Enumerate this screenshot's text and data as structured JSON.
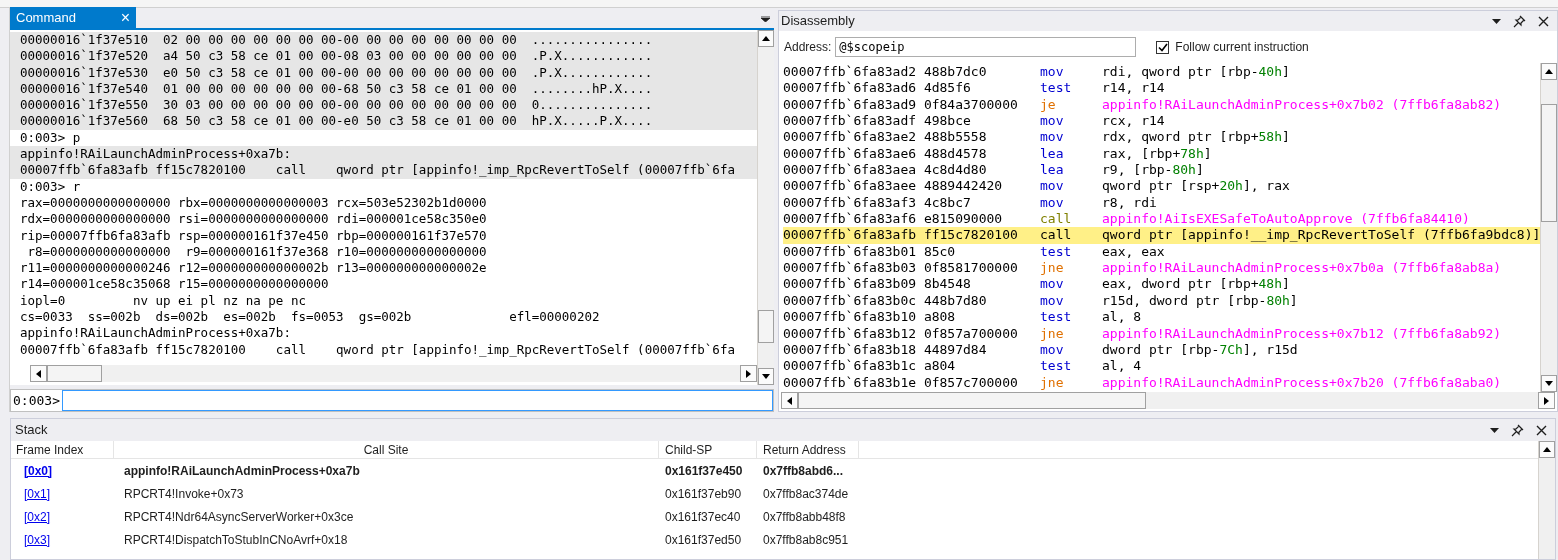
{
  "command_panel": {
    "tab": {
      "label": "Command",
      "selected": true,
      "close": "×"
    },
    "lines": [
      {
        "text": "00000016`1f37e510  02 00 00 00 00 00 00 00-00 00 00 00 00 00 00 00  ................",
        "shaded": true
      },
      {
        "text": "00000016`1f37e520  a4 50 c3 58 ce 01 00 00-08 03 00 00 00 00 00 00  .P.X............",
        "shaded": true
      },
      {
        "text": "00000016`1f37e530  e0 50 c3 58 ce 01 00 00-00 00 00 00 00 00 00 00  .P.X............",
        "shaded": true
      },
      {
        "text": "00000016`1f37e540  01 00 00 00 00 00 00 00-68 50 c3 58 ce 01 00 00  ........hP.X....",
        "shaded": true
      },
      {
        "text": "00000016`1f37e550  30 03 00 00 00 00 00 00-00 00 00 00 00 00 00 00  0...............",
        "shaded": true
      },
      {
        "text": "00000016`1f37e560  68 50 c3 58 ce 01 00 00-e0 50 c3 58 ce 01 00 00  hP.X.....P.X....",
        "shaded": true
      },
      {
        "text": "0:003> p",
        "shaded": false
      },
      {
        "text": "appinfo!RAiLaunchAdminProcess+0xa7b:",
        "shaded": true
      },
      {
        "text": "00007ffb`6fa83afb ff15c7820100    call    qword ptr [appinfo!_imp_RpcRevertToSelf (00007ffb`6fa",
        "shaded": true
      },
      {
        "text": "0:003> r",
        "shaded": false
      },
      {
        "text": "rax=0000000000000000 rbx=0000000000000003 rcx=503e52302b1d0000",
        "shaded": false
      },
      {
        "text": "rdx=0000000000000000 rsi=0000000000000000 rdi=000001ce58c350e0",
        "shaded": false
      },
      {
        "text": "rip=00007ffb6fa83afb rsp=000000161f37e450 rbp=000000161f37e570",
        "shaded": false
      },
      {
        "text": " r8=0000000000000000  r9=000000161f37e368 r10=0000000000000000",
        "shaded": false
      },
      {
        "text": "r11=0000000000000246 r12=000000000000002b r13=000000000000002e",
        "shaded": false
      },
      {
        "text": "r14=000001ce58c35068 r15=0000000000000000",
        "shaded": false
      },
      {
        "text": "iopl=0         nv up ei pl nz na pe nc",
        "shaded": false
      },
      {
        "text": "cs=0033  ss=002b  ds=002b  es=002b  fs=0053  gs=002b             efl=00000202",
        "shaded": false
      },
      {
        "text": "appinfo!RAiLaunchAdminProcess+0xa7b:",
        "shaded": false
      },
      {
        "text": "00007ffb`6fa83afb ff15c7820100    call    qword ptr [appinfo!_imp_RpcRevertToSelf (00007ffb`6fa",
        "shaded": false
      }
    ],
    "prompt": "0:003>"
  },
  "disassembly": {
    "title": "Disassembly",
    "address_label": "Address:",
    "address_value": "@$scopeip",
    "follow": {
      "label": "Follow current instruction",
      "checked": true
    },
    "rows": [
      {
        "addr": "00007ffb`6fa83ad2 488b7dc0",
        "mnemonic": "mov",
        "kind": "data",
        "current": false,
        "operands": [
          {
            "t": "rdi, qword ptr [rbp-",
            "kind": "plain"
          },
          {
            "t": "40h",
            "kind": "number"
          },
          {
            "t": "]",
            "kind": "plain"
          }
        ]
      },
      {
        "addr": "00007ffb`6fa83ad6 4d85f6",
        "mnemonic": "test",
        "kind": "data",
        "current": false,
        "operands": [
          {
            "t": "r14, r14",
            "kind": "plain"
          }
        ]
      },
      {
        "addr": "00007ffb`6fa83ad9 0f84a3700000",
        "mnemonic": "je",
        "kind": "branch",
        "current": false,
        "operands": [
          {
            "t": "appinfo!RAiLaunchAdminProcess+0x7b02 (7ffb6fa8ab82)",
            "kind": "symbol"
          }
        ]
      },
      {
        "addr": "00007ffb`6fa83adf 498bce",
        "mnemonic": "mov",
        "kind": "data",
        "current": false,
        "operands": [
          {
            "t": "rcx, r14",
            "kind": "plain"
          }
        ]
      },
      {
        "addr": "00007ffb`6fa83ae2 488b5558",
        "mnemonic": "mov",
        "kind": "data",
        "current": false,
        "operands": [
          {
            "t": "rdx, qword ptr [rbp+",
            "kind": "plain"
          },
          {
            "t": "58h",
            "kind": "number"
          },
          {
            "t": "]",
            "kind": "plain"
          }
        ]
      },
      {
        "addr": "00007ffb`6fa83ae6 488d4578",
        "mnemonic": "lea",
        "kind": "data",
        "current": false,
        "operands": [
          {
            "t": "rax, [rbp+",
            "kind": "plain"
          },
          {
            "t": "78h",
            "kind": "number"
          },
          {
            "t": "]",
            "kind": "plain"
          }
        ]
      },
      {
        "addr": "00007ffb`6fa83aea 4c8d4d80",
        "mnemonic": "lea",
        "kind": "data",
        "current": false,
        "operands": [
          {
            "t": "r9, [rbp-",
            "kind": "plain"
          },
          {
            "t": "80h",
            "kind": "number"
          },
          {
            "t": "]",
            "kind": "plain"
          }
        ]
      },
      {
        "addr": "00007ffb`6fa83aee 4889442420",
        "mnemonic": "mov",
        "kind": "data",
        "current": false,
        "operands": [
          {
            "t": "qword ptr [rsp+",
            "kind": "plain"
          },
          {
            "t": "20h",
            "kind": "number"
          },
          {
            "t": "], rax",
            "kind": "plain"
          }
        ]
      },
      {
        "addr": "00007ffb`6fa83af3 4c8bc7",
        "mnemonic": "mov",
        "kind": "data",
        "current": false,
        "operands": [
          {
            "t": "r8, rdi",
            "kind": "plain"
          }
        ]
      },
      {
        "addr": "00007ffb`6fa83af6 e815090000",
        "mnemonic": "call",
        "kind": "call",
        "current": false,
        "operands": [
          {
            "t": "appinfo!AiIsEXESafeToAutoApprove (7ffb6fa84410)",
            "kind": "symbol"
          }
        ]
      },
      {
        "addr": "00007ffb`6fa83afb ff15c7820100",
        "mnemonic": "call",
        "kind": "call",
        "current": true,
        "operands": [
          {
            "t": "qword ptr [appinfo!__imp_RpcRevertToSelf (7ffb6fa9bdc8)]",
            "kind": "plain"
          }
        ]
      },
      {
        "addr": "00007ffb`6fa83b01 85c0",
        "mnemonic": "test",
        "kind": "data",
        "current": false,
        "operands": [
          {
            "t": "eax, eax",
            "kind": "plain"
          }
        ]
      },
      {
        "addr": "00007ffb`6fa83b03 0f8581700000",
        "mnemonic": "jne",
        "kind": "branch",
        "current": false,
        "operands": [
          {
            "t": "appinfo!RAiLaunchAdminProcess+0x7b0a (7ffb6fa8ab8a)",
            "kind": "symbol"
          }
        ]
      },
      {
        "addr": "00007ffb`6fa83b09 8b4548",
        "mnemonic": "mov",
        "kind": "data",
        "current": false,
        "operands": [
          {
            "t": "eax, dword ptr [rbp+",
            "kind": "plain"
          },
          {
            "t": "48h",
            "kind": "number"
          },
          {
            "t": "]",
            "kind": "plain"
          }
        ]
      },
      {
        "addr": "00007ffb`6fa83b0c 448b7d80",
        "mnemonic": "mov",
        "kind": "data",
        "current": false,
        "operands": [
          {
            "t": "r15d, dword ptr [rbp-",
            "kind": "plain"
          },
          {
            "t": "80h",
            "kind": "number"
          },
          {
            "t": "]",
            "kind": "plain"
          }
        ]
      },
      {
        "addr": "00007ffb`6fa83b10 a808",
        "mnemonic": "test",
        "kind": "data",
        "current": false,
        "operands": [
          {
            "t": "al, 8",
            "kind": "plain"
          }
        ]
      },
      {
        "addr": "00007ffb`6fa83b12 0f857a700000",
        "mnemonic": "jne",
        "kind": "branch",
        "current": false,
        "operands": [
          {
            "t": "appinfo!RAiLaunchAdminProcess+0x7b12 (7ffb6fa8ab92)",
            "kind": "symbol"
          }
        ]
      },
      {
        "addr": "00007ffb`6fa83b18 44897d84",
        "mnemonic": "mov",
        "kind": "data",
        "current": false,
        "operands": [
          {
            "t": "dword ptr [rbp-",
            "kind": "plain"
          },
          {
            "t": "7Ch",
            "kind": "number"
          },
          {
            "t": "], r15d",
            "kind": "plain"
          }
        ]
      },
      {
        "addr": "00007ffb`6fa83b1c a804",
        "mnemonic": "test",
        "kind": "data",
        "current": false,
        "operands": [
          {
            "t": "al, 4",
            "kind": "plain"
          }
        ]
      },
      {
        "addr": "00007ffb`6fa83b1e 0f857c700000",
        "mnemonic": "jne",
        "kind": "branch",
        "current": false,
        "operands": [
          {
            "t": "appinfo!RAiLaunchAdminProcess+0x7b20 (7ffb6fa8aba0)",
            "kind": "symbol"
          }
        ]
      }
    ]
  },
  "stack": {
    "title": "Stack",
    "columns": [
      "Frame Index",
      "Call Site",
      "Child-SP",
      "Return Address"
    ],
    "rows": [
      {
        "index": "[0x0]",
        "call_site": "appinfo!RAiLaunchAdminProcess+0xa7b",
        "child_sp": "0x161f37e450",
        "return_address": "0x7ffb8abd6...",
        "selected": true
      },
      {
        "index": "[0x1]",
        "call_site": "RPCRT4!Invoke+0x73",
        "child_sp": "0x161f37eb90",
        "return_address": "0x7ffb8ac374de",
        "selected": false
      },
      {
        "index": "[0x2]",
        "call_site": "RPCRT4!Ndr64AsyncServerWorker+0x3ce",
        "child_sp": "0x161f37ec40",
        "return_address": "0x7ffb8abb48f8",
        "selected": false
      },
      {
        "index": "[0x3]",
        "call_site": "RPCRT4!DispatchToStubInCNoAvrf+0x18",
        "child_sp": "0x161f37ed50",
        "return_address": "0x7ffb8ab8c951",
        "selected": false
      }
    ]
  }
}
